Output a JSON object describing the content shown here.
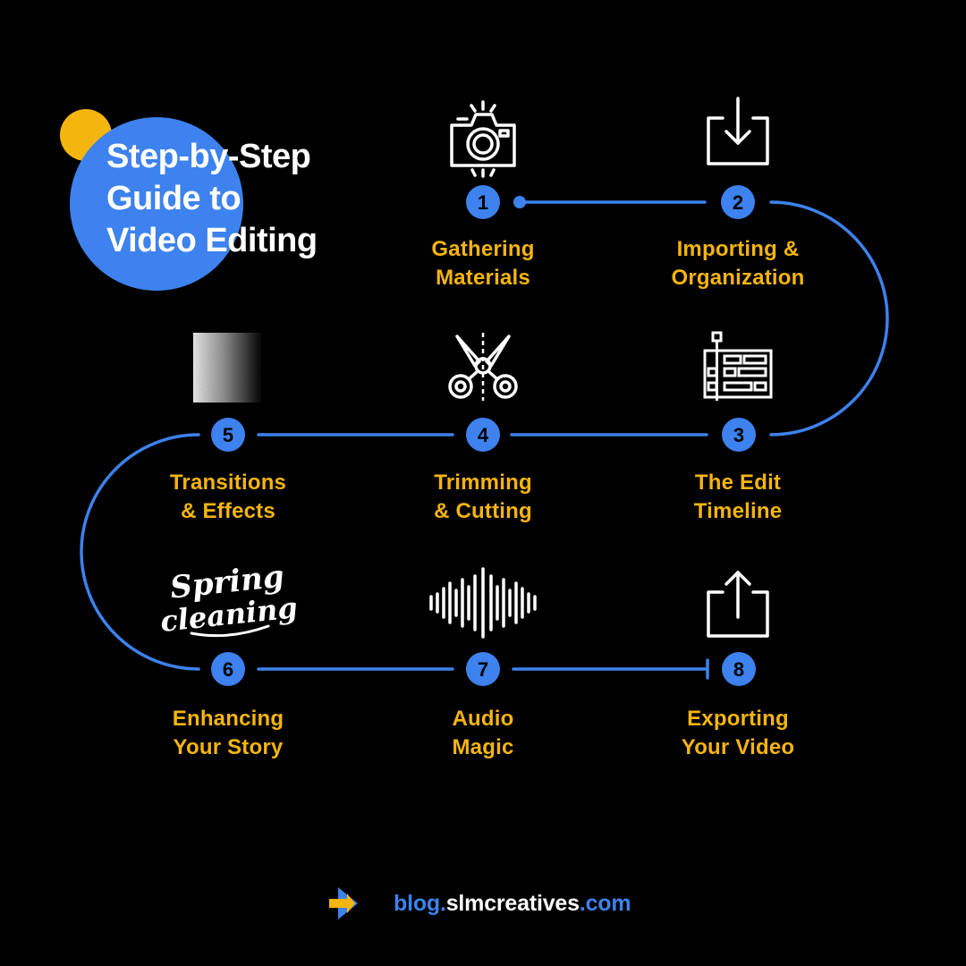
{
  "title": {
    "line1": "Step-by-Step",
    "line2": "Guide to",
    "line3": "Video Editing"
  },
  "steps": [
    {
      "num": "1",
      "line1": "Gathering",
      "line2": "Materials",
      "icon": "camera-icon"
    },
    {
      "num": "2",
      "line1": "Importing &",
      "line2": "Organization",
      "icon": "import-icon"
    },
    {
      "num": "3",
      "line1": "The Edit",
      "line2": "Timeline",
      "icon": "timeline-icon"
    },
    {
      "num": "4",
      "line1": "Trimming",
      "line2": "& Cutting",
      "icon": "scissors-icon"
    },
    {
      "num": "5",
      "line1": "Transitions",
      "line2": "& Effects",
      "icon": "gradient-noise-icon"
    },
    {
      "num": "6",
      "line1": "Enhancing",
      "line2": "Your Story",
      "icon": "spring-cleaning-lettering-icon"
    },
    {
      "num": "7",
      "line1": "Audio",
      "line2": "Magic",
      "icon": "soundwave-icon"
    },
    {
      "num": "8",
      "line1": "Exporting",
      "line2": "Your Video",
      "icon": "export-icon"
    }
  ],
  "footer": {
    "icon": "arrow-logo-icon",
    "url_prefix": "blog.",
    "url_main": "slmcreatives",
    "url_suffix": ".com"
  },
  "colors": {
    "background": "#000000",
    "accent_blue": "#3D82EE",
    "accent_yellow": "#F5B50F",
    "text_white": "#FFFFFF"
  }
}
